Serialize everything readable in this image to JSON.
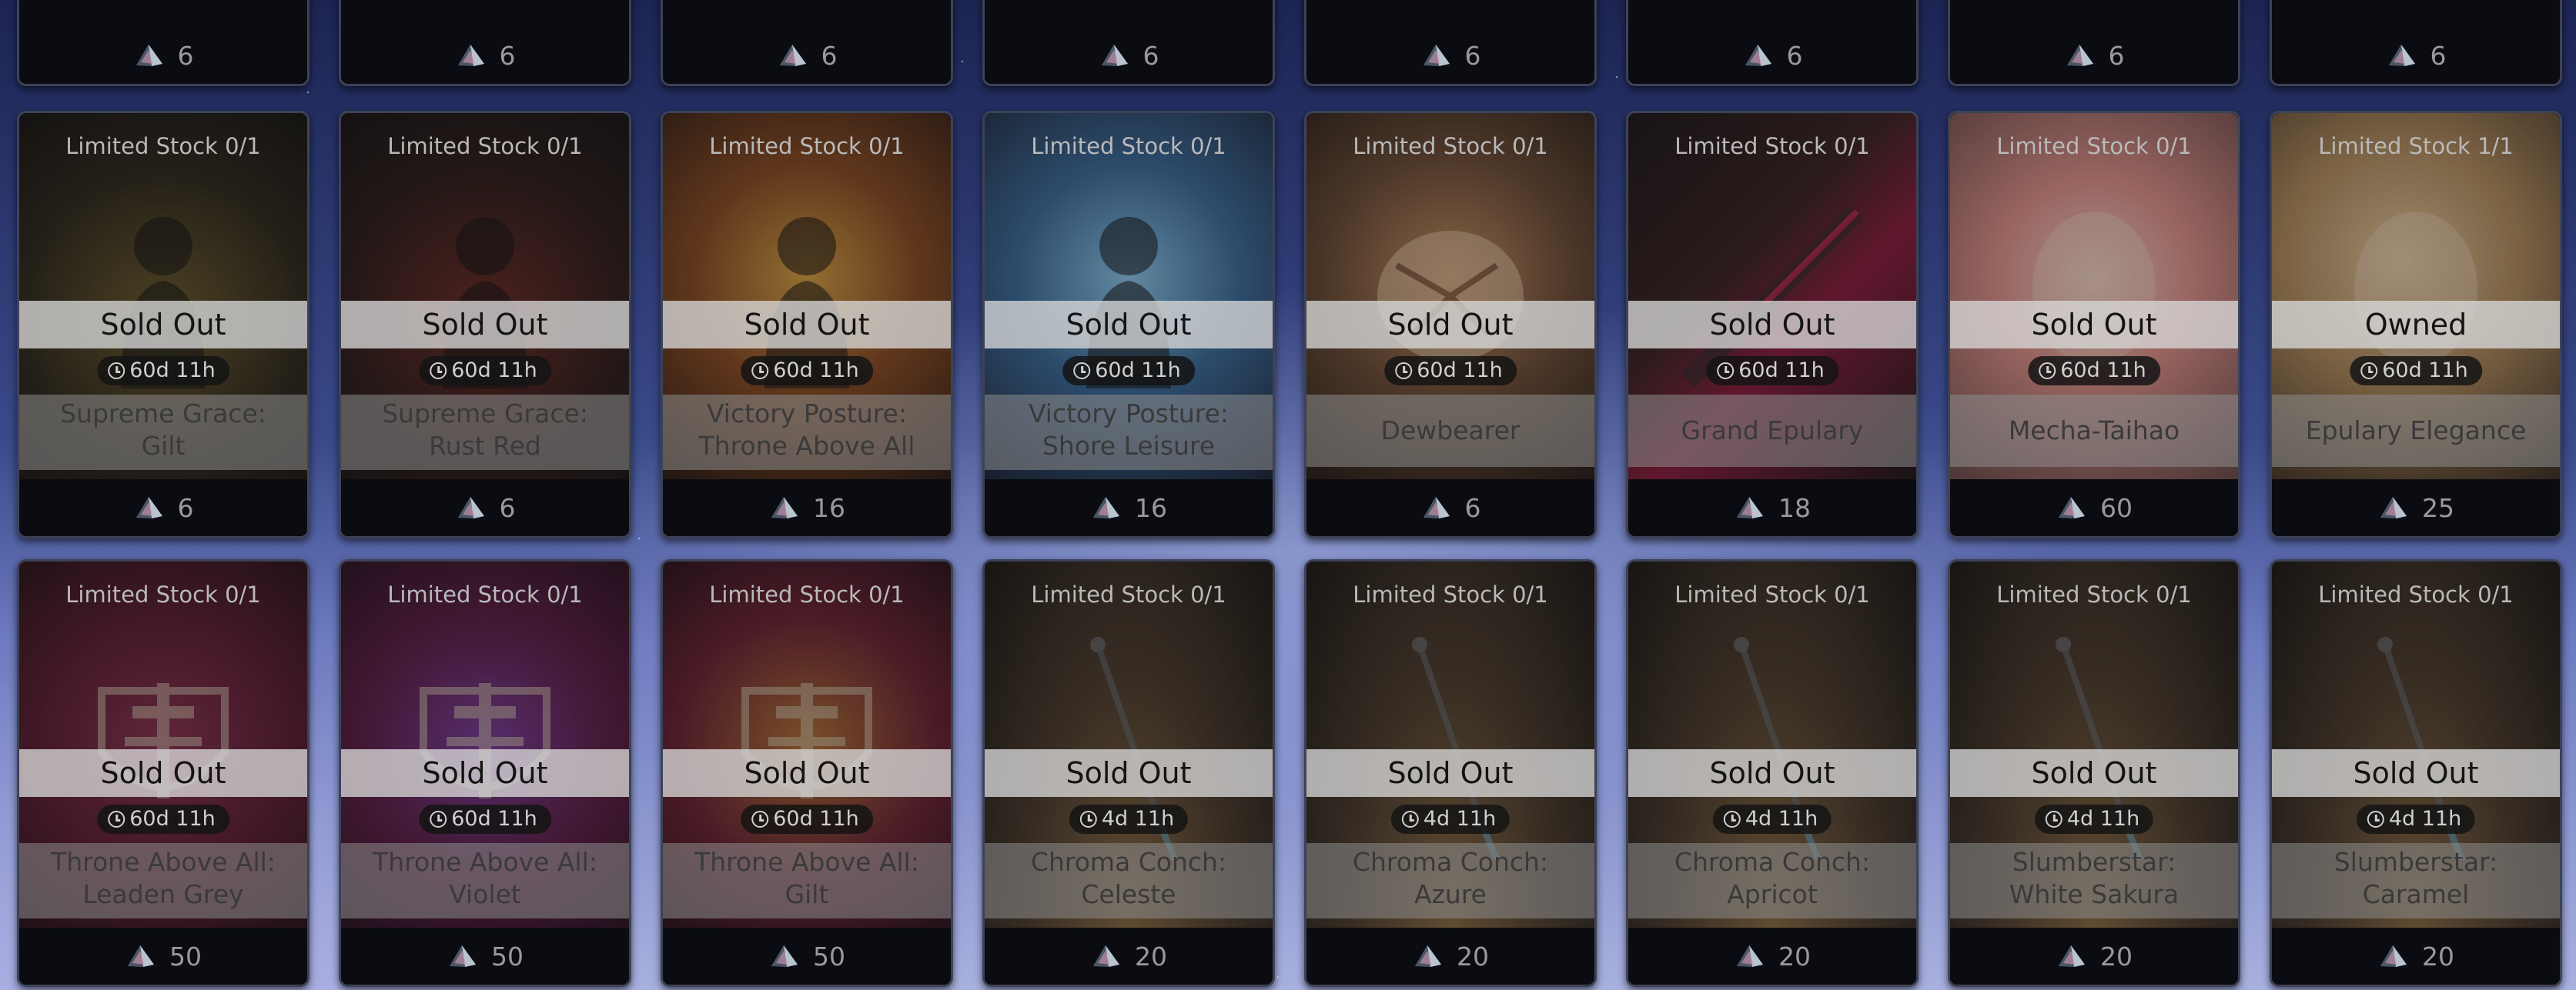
{
  "top_row": [
    {
      "price": "6"
    },
    {
      "price": "6"
    },
    {
      "price": "6"
    },
    {
      "price": "6"
    },
    {
      "price": "6"
    },
    {
      "price": "6"
    },
    {
      "price": "6"
    },
    {
      "price": "6"
    }
  ],
  "middle_row": [
    {
      "stock": "Limited Stock 0/1",
      "status": "Sold Out",
      "timer": "60d 11h",
      "name_l1": "Supreme Grace:",
      "name_l2": "Gilt",
      "price": "6",
      "theme": "gilt"
    },
    {
      "stock": "Limited Stock 0/1",
      "status": "Sold Out",
      "timer": "60d 11h",
      "name_l1": "Supreme Grace:",
      "name_l2": "Rust Red",
      "price": "6",
      "theme": "red"
    },
    {
      "stock": "Limited Stock 0/1",
      "status": "Sold Out",
      "timer": "60d 11h",
      "name_l1": "Victory Posture:",
      "name_l2": "Throne Above All",
      "price": "16",
      "theme": "sun"
    },
    {
      "stock": "Limited Stock 0/1",
      "status": "Sold Out",
      "timer": "60d 11h",
      "name_l1": "Victory Posture:",
      "name_l2": "Shore Leisure",
      "price": "16",
      "theme": "sea"
    },
    {
      "stock": "Limited Stock 0/1",
      "status": "Sold Out",
      "timer": "60d 11h",
      "name_l1": "Dewbearer",
      "name_l2": "",
      "price": "6",
      "theme": "amber"
    },
    {
      "stock": "Limited Stock 0/1",
      "status": "Sold Out",
      "timer": "60d 11h",
      "name_l1": "Grand Epulary",
      "name_l2": "",
      "price": "18",
      "theme": "crimson"
    },
    {
      "stock": "Limited Stock 0/1",
      "status": "Sold Out",
      "timer": "60d 11h",
      "name_l1": "Mecha-Taihao",
      "name_l2": "",
      "price": "60",
      "theme": "pink"
    },
    {
      "stock": "Limited Stock 1/1",
      "status": "Owned",
      "timer": "60d 11h",
      "name_l1": "Epulary Elegance",
      "name_l2": "",
      "price": "25",
      "theme": "blonde"
    }
  ],
  "bottom_row": [
    {
      "stock": "Limited Stock 0/1",
      "status": "Sold Out",
      "timer": "60d 11h",
      "name_l1": "Throne Above All:",
      "name_l2": "Leaden Grey",
      "price": "50",
      "theme": "crest-r"
    },
    {
      "stock": "Limited Stock 0/1",
      "status": "Sold Out",
      "timer": "60d 11h",
      "name_l1": "Throne Above All:",
      "name_l2": "Violet",
      "price": "50",
      "theme": "crest-v"
    },
    {
      "stock": "Limited Stock 0/1",
      "status": "Sold Out",
      "timer": "60d 11h",
      "name_l1": "Throne Above All:",
      "name_l2": "Gilt",
      "price": "50",
      "theme": "crest-g"
    },
    {
      "stock": "Limited Stock 0/1",
      "status": "Sold Out",
      "timer": "4d 11h",
      "name_l1": "Chroma Conch:",
      "name_l2": "Celeste",
      "price": "20",
      "theme": "staff"
    },
    {
      "stock": "Limited Stock 0/1",
      "status": "Sold Out",
      "timer": "4d 11h",
      "name_l1": "Chroma Conch:",
      "name_l2": "Azure",
      "price": "20",
      "theme": "staff"
    },
    {
      "stock": "Limited Stock 0/1",
      "status": "Sold Out",
      "timer": "4d 11h",
      "name_l1": "Chroma Conch:",
      "name_l2": "Apricot",
      "price": "20",
      "theme": "staff"
    },
    {
      "stock": "Limited Stock 0/1",
      "status": "Sold Out",
      "timer": "4d 11h",
      "name_l1": "Slumberstar:",
      "name_l2": "White Sakura",
      "price": "20",
      "theme": "staff"
    },
    {
      "stock": "Limited Stock 0/1",
      "status": "Sold Out",
      "timer": "4d 11h",
      "name_l1": "Slumberstar:",
      "name_l2": "Caramel",
      "price": "20",
      "theme": "staff"
    }
  ],
  "icons": {
    "currency": "prism-gem-icon",
    "timer": "clock-icon"
  }
}
